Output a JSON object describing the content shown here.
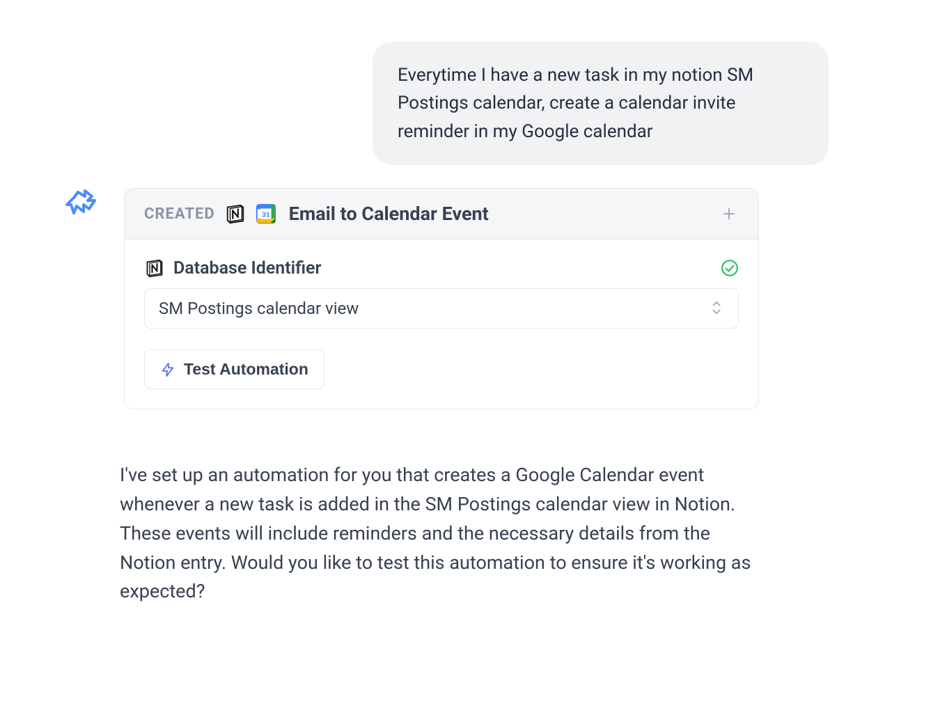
{
  "user_message": "Everytime I have a new task in my notion SM Postings calendar, create a calendar invite reminder in my Google calendar",
  "automation": {
    "status": "CREATED",
    "title": "Email to Calendar Event",
    "field": {
      "label": "Database Identifier",
      "selected": "SM Postings calendar view"
    },
    "test_button": "Test Automation"
  },
  "assistant_reply": "I've set up an automation for you that creates a Google Calendar event whenever a new task is added in the SM Postings calendar view in Notion. These events will include reminders and the necessary details from the Notion entry. Would you like to test this automation to ensure it's working as expected?"
}
